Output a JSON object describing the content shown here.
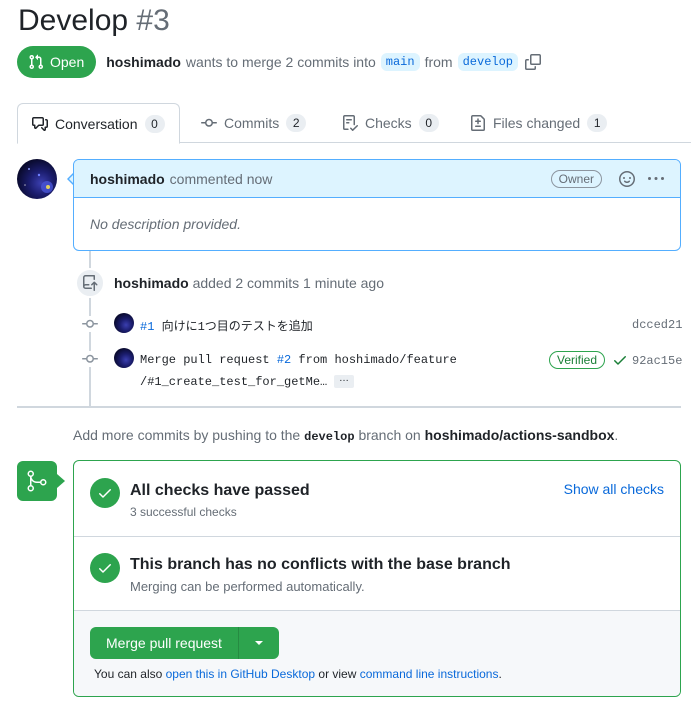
{
  "header": {
    "title": "Develop",
    "number": "#3"
  },
  "state": {
    "label": "Open",
    "author": "hoshimado",
    "merge_text": "wants to merge 2 commits into",
    "base_branch": "main",
    "from_text": "from",
    "head_branch": "develop"
  },
  "tabs": [
    {
      "label": "Conversation",
      "count": "0",
      "icon": "comment-discussion-icon",
      "active": true
    },
    {
      "label": "Commits",
      "count": "2",
      "icon": "git-commit-icon"
    },
    {
      "label": "Checks",
      "count": "0",
      "icon": "checklist-icon"
    },
    {
      "label": "Files changed",
      "count": "1",
      "icon": "file-diff-icon"
    }
  ],
  "comment": {
    "author": "hoshimado",
    "when": "commented now",
    "badge": "Owner",
    "body": "No description provided."
  },
  "push_event": {
    "author": "hoshimado",
    "text": "added 2 commits 1 minute ago"
  },
  "commits": [
    {
      "link": "#1",
      "message": " 向けに1つ目のテストを追加",
      "sha": "dcced21"
    },
    {
      "message_prefix": "Merge pull request ",
      "link": "#2",
      "message_suffix": " from hoshimado/feature",
      "message_line2": "/#1_create_test_for_getMe…",
      "ellipsis": "…",
      "verified": "Verified",
      "sha": "92ac15e"
    }
  ],
  "add_more": {
    "prefix": "Add more commits by pushing to the",
    "branch": "develop",
    "middle": "branch on",
    "repo": "hoshimado/actions-sandbox",
    "suffix": "."
  },
  "merge_box": {
    "checks_title": "All checks have passed",
    "checks_sub": "3 successful checks",
    "show_all": "Show all checks",
    "conflicts_title": "This branch has no conflicts with the base branch",
    "conflicts_sub": "Merging can be performed automatically.",
    "merge_button": "Merge pull request",
    "also_prefix": "You can also",
    "desktop_link": "open this in GitHub Desktop",
    "also_middle": "or view",
    "cli_link": "command line instructions",
    "also_suffix": "."
  },
  "colors": {
    "success": "#2da44e",
    "accent": "#0969da",
    "comment_border": "#54aeff",
    "comment_header_bg": "#ddf4ff"
  }
}
